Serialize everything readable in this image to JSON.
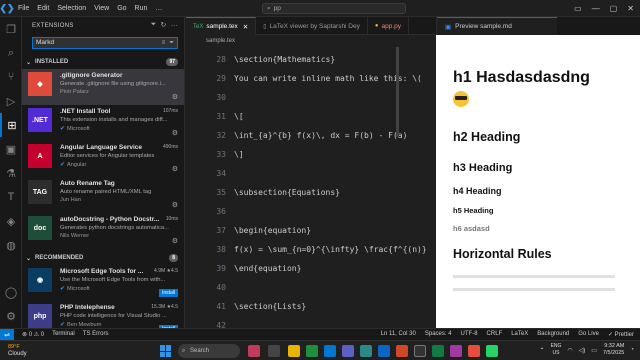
{
  "titlebar": {
    "menu": [
      "File",
      "Edit",
      "Selection",
      "View",
      "Go",
      "Run",
      "…"
    ],
    "nav_back": "←",
    "nav_fwd": "→",
    "command_center": "pp"
  },
  "sidebar": {
    "title": "EXTENSIONS",
    "search_value": "Markd",
    "installed_label": "INSTALLED",
    "installed_count": "97",
    "recommended_label": "RECOMMENDED",
    "recommended_count": "8",
    "installed": [
      {
        "name": ".gitignore Generator",
        "desc": "Generate .gitignore file using gitignore.i...",
        "publisher": "Piotr Palarz",
        "meta": "",
        "verified": false,
        "logo_text": "◆",
        "logo_bg": "#e04a3a"
      },
      {
        "name": ".NET Install Tool",
        "desc": "This extension installs and manages diff...",
        "publisher": "Microsoft",
        "meta": "107ms",
        "verified": true,
        "logo_text": ".NET",
        "logo_bg": "#512bd4"
      },
      {
        "name": "Angular Language Service",
        "desc": "Editor services for Angular templates",
        "publisher": "Angular",
        "meta": "490ms",
        "verified": true,
        "logo_text": "A",
        "logo_bg": "#c3002f"
      },
      {
        "name": "Auto Rename Tag",
        "desc": "Auto rename paired HTML/XML tag",
        "publisher": "Jun Han",
        "meta": "",
        "verified": false,
        "logo_text": "TAG",
        "logo_bg": "#2d2d2d"
      },
      {
        "name": "autoDocstring - Python Docstr...",
        "desc": "Generates python docstrings automatica...",
        "publisher": "Nils Werner",
        "meta": "10ms",
        "verified": false,
        "logo_text": "doc",
        "logo_bg": "#1e4d3a"
      }
    ],
    "recommended": [
      {
        "name": "Microsoft Edge Tools for ...",
        "desc": "Use the Microsoft Edge Tools from with...",
        "publisher": "Microsoft",
        "meta": "4.9M ★4.5",
        "verified": true,
        "logo_text": "◉",
        "logo_bg": "#0a3d62",
        "install": "Install"
      },
      {
        "name": "PHP Intelephense",
        "desc": "PHP code intelligence for Visual Studio ...",
        "publisher": "Ben Mewburn",
        "meta": "15.3M ★4.5",
        "verified": true,
        "logo_text": "php",
        "logo_bg": "#3c3c88",
        "install": "Install"
      }
    ]
  },
  "tabs": [
    {
      "label": "sample.tex",
      "icon": "TeX",
      "active": true
    },
    {
      "label": "LaTeX viewer by Saptarshi Dey",
      "icon": "▯",
      "active": false
    },
    {
      "label": "app.py",
      "icon": "●",
      "active": false
    }
  ],
  "breadcrumb": "sample.tex",
  "editor_lines": [
    {
      "n": "28",
      "code": "\\section{Mathematics}"
    },
    {
      "n": "29",
      "code": "You can write inline math like this: \\("
    },
    {
      "n": "30",
      "code": ""
    },
    {
      "n": "31",
      "code": "\\["
    },
    {
      "n": "32",
      "code": "\\int_{a}^{b} f(x)\\, dx = F(b) - F(a)"
    },
    {
      "n": "33",
      "code": "\\]"
    },
    {
      "n": "34",
      "code": ""
    },
    {
      "n": "35",
      "code": "\\subsection{Equations}"
    },
    {
      "n": "36",
      "code": ""
    },
    {
      "n": "37",
      "code": "\\begin{equation}"
    },
    {
      "n": "38",
      "code": "f(x) = \\sum_{n=0}^{\\infty} \\frac{f^{(n)}"
    },
    {
      "n": "39",
      "code": "\\end{equation}"
    },
    {
      "n": "40",
      "code": ""
    },
    {
      "n": "41",
      "code": "\\section{Lists}"
    },
    {
      "n": "42",
      "code": ""
    }
  ],
  "preview": {
    "tab_label": "Preview sample.md",
    "h1": "h1 Hasdasdasdng",
    "h2": "h2 Heading",
    "h3": "h3 Heading",
    "h4": "h4 Heading",
    "h5": "h5 Heading",
    "h6": "h6 asdasd",
    "h2b": "Horizontal Rules"
  },
  "status": {
    "remote": "⇌",
    "errors": "⊗ 0 ⚠ 0",
    "terminal": "Terminal",
    "ts_errors": "TS Errors",
    "position": "Ln 11, Col 30",
    "spaces": "Spaces: 4",
    "encoding": "UTF-8",
    "eol": "CRLF",
    "language": "LaTeX",
    "background": "Background",
    "golive": "Go Live",
    "prettier": "✓ Prettier"
  },
  "taskbar": {
    "temp": "89°F",
    "weather": "Cloudy",
    "search": "Search",
    "lang1": "ENG",
    "lang2": "US",
    "time": "9:32 AM",
    "date": "7/5/2025"
  },
  "colors": {
    "accent": "#0078d4",
    "install": "#0078d4"
  }
}
